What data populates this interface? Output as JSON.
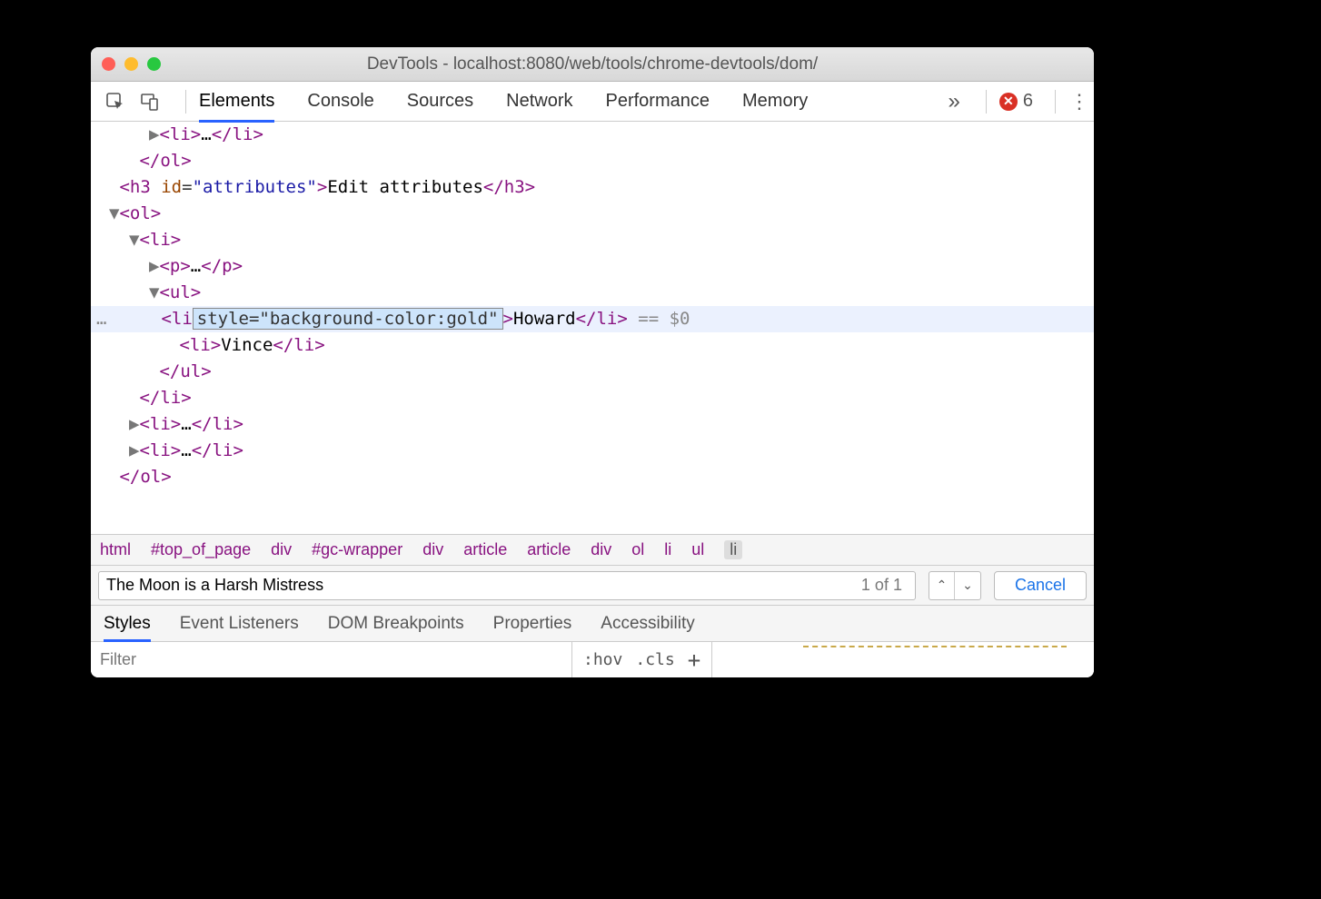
{
  "titlebar": {
    "title": "DevTools - localhost:8080/web/tools/chrome-devtools/dom/"
  },
  "toolbar": {
    "tabs": [
      "Elements",
      "Console",
      "Sources",
      "Network",
      "Performance",
      "Memory"
    ],
    "active_tab_index": 0,
    "errors_count": "6"
  },
  "dom_rows": [
    {
      "indent": 10,
      "kind": "collapsed",
      "pre": "▶",
      "html": "<li>…</li>"
    },
    {
      "indent": 9,
      "kind": "close",
      "html": "</ol>"
    },
    {
      "indent": 8,
      "kind": "open-attr",
      "tag": "h3",
      "attr": "id",
      "val": "\"attributes\"",
      "text": "Edit attributes",
      "close": "</h3>"
    },
    {
      "indent": 8,
      "kind": "expand",
      "pre": "▼",
      "html": "<ol>"
    },
    {
      "indent": 9,
      "kind": "expand",
      "pre": "▼",
      "html": "<li>"
    },
    {
      "indent": 10,
      "kind": "collapsed",
      "pre": "▶",
      "html": "<p>…</p>"
    },
    {
      "indent": 10,
      "kind": "expand",
      "pre": "▼",
      "html": "<ul>"
    },
    {
      "indent": 11,
      "kind": "selected",
      "tag": "li",
      "edit": "style=\"background-color:gold\"",
      "text": "Howard",
      "close": "</li>"
    },
    {
      "indent": 11,
      "kind": "plain",
      "tag": "li",
      "text": "Vince",
      "close": "</li>"
    },
    {
      "indent": 10,
      "kind": "close",
      "html": "</ul>"
    },
    {
      "indent": 9,
      "kind": "close",
      "html": "</li>"
    },
    {
      "indent": 9,
      "kind": "collapsed",
      "pre": "▶",
      "html": "<li>…</li>"
    },
    {
      "indent": 9,
      "kind": "collapsed",
      "pre": "▶",
      "html": "<li>…</li>"
    },
    {
      "indent": 8,
      "kind": "close",
      "html": "</ol>"
    },
    {
      "indent": 8,
      "kind": "cutoff"
    }
  ],
  "selected_suffix": " == $0",
  "breadcrumbs": [
    "html",
    "#top_of_page",
    "div",
    "#gc-wrapper",
    "div",
    "article",
    "article",
    "div",
    "ol",
    "li",
    "ul",
    "li"
  ],
  "breadcrumb_selected_index": 11,
  "search": {
    "value": "The Moon is a Harsh Mistress",
    "count": "1 of 1",
    "cancel": "Cancel"
  },
  "subtabs": [
    "Styles",
    "Event Listeners",
    "DOM Breakpoints",
    "Properties",
    "Accessibility"
  ],
  "subtab_active_index": 0,
  "filter": {
    "placeholder": "Filter",
    "hov": ":hov",
    "cls": ".cls"
  }
}
